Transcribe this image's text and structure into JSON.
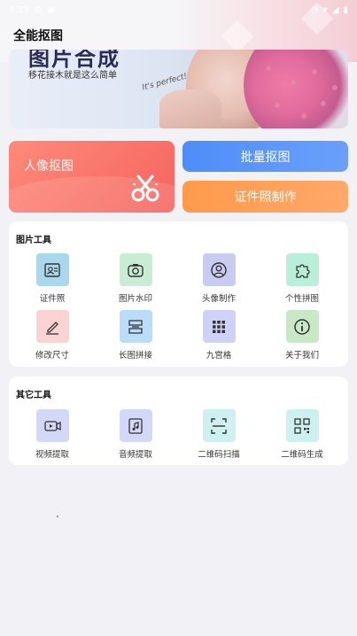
{
  "status_bar": {
    "time": "8:19",
    "left_icons": [
      "gear-icon",
      "shield-icon"
    ],
    "right_icons": [
      "alarm-icon",
      "wifi-icon",
      "signal-icon",
      "battery-icon"
    ]
  },
  "header": {
    "title": "全能抠图"
  },
  "banner": {
    "headline": "图片合成",
    "subtitle": "移花接木就是这么简单",
    "signature": "It's perfect!"
  },
  "features": {
    "portrait_label": "人像抠图",
    "batch_label": "批量抠图",
    "idphoto_label": "证件照制作"
  },
  "image_tools": {
    "title": "图片工具",
    "items": [
      {
        "label": "证件照",
        "icon": "id-card-icon",
        "bg": "#a9d8ec"
      },
      {
        "label": "图片水印",
        "icon": "camera-icon",
        "bg": "#c8ecd4"
      },
      {
        "label": "头像制作",
        "icon": "avatar-icon",
        "bg": "#c9cbf0"
      },
      {
        "label": "个性拼图",
        "icon": "puzzle-icon",
        "bg": "#b9efd8"
      },
      {
        "label": "修改尺寸",
        "icon": "pencil-icon",
        "bg": "#fcd3d3"
      },
      {
        "label": "长图拼接",
        "icon": "stitch-icon",
        "bg": "#b9dcf8"
      },
      {
        "label": "九宫格",
        "icon": "grid-icon",
        "bg": "#cfd2f6"
      },
      {
        "label": "关于我们",
        "icon": "info-icon",
        "bg": "#c9e9c6"
      }
    ]
  },
  "other_tools": {
    "title": "其它工具",
    "items": [
      {
        "label": "视频提取",
        "icon": "video-icon",
        "bg": "#d4d8f8"
      },
      {
        "label": "音频提取",
        "icon": "music-file-icon",
        "bg": "#d4d8f8"
      },
      {
        "label": "二维码扫描",
        "icon": "qr-scan-icon",
        "bg": "#cdf1f0"
      },
      {
        "label": "二维码生成",
        "icon": "qr-code-icon",
        "bg": "#cdf1f0"
      }
    ]
  }
}
